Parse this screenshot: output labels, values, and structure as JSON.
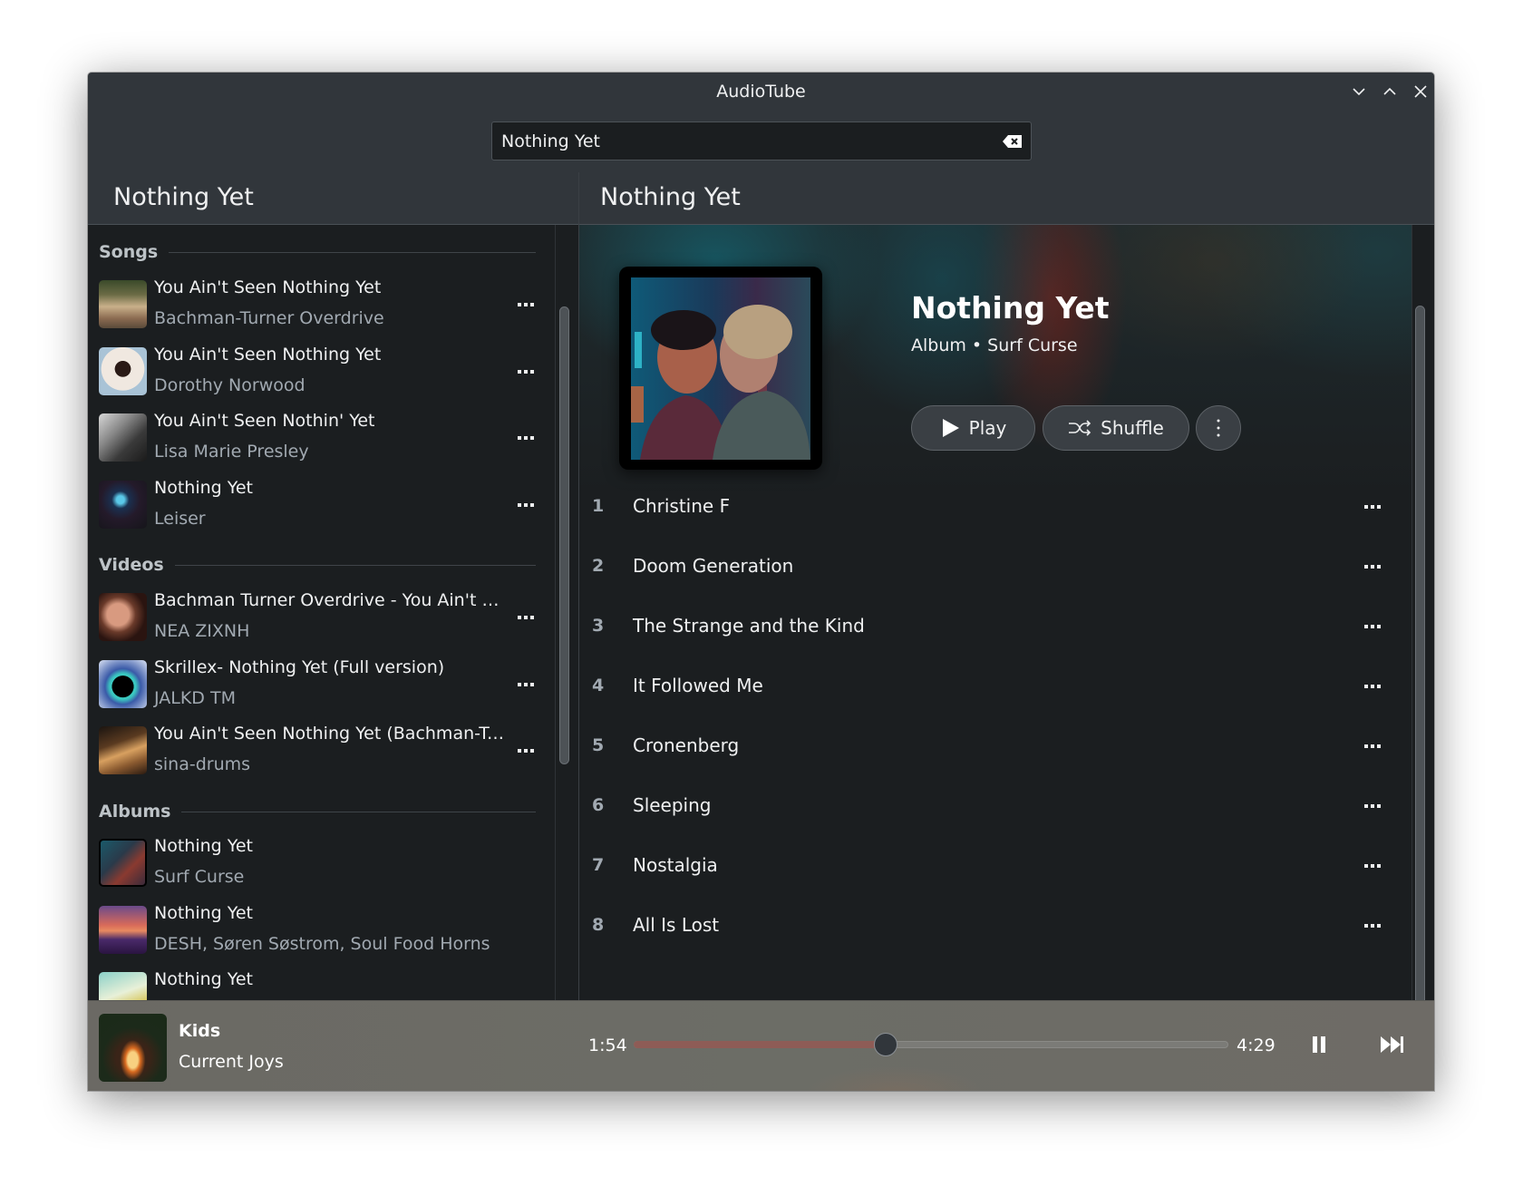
{
  "window": {
    "title": "AudioTube",
    "controls": [
      "minimize",
      "maximize",
      "close"
    ]
  },
  "search": {
    "value": "Nothing Yet",
    "placeholder": "",
    "clear_icon": "clear-text-icon"
  },
  "left_panel": {
    "header": "Nothing Yet",
    "sections": [
      {
        "title": "Songs",
        "items": [
          {
            "title": "You Ain't Seen Nothing Yet",
            "subtitle": "Bachman-Turner Overdrive"
          },
          {
            "title": "You Ain't Seen Nothing Yet",
            "subtitle": "Dorothy Norwood"
          },
          {
            "title": "You Ain't Seen Nothin' Yet",
            "subtitle": "Lisa Marie Presley"
          },
          {
            "title": "Nothing Yet",
            "subtitle": "Leiser"
          }
        ]
      },
      {
        "title": "Videos",
        "items": [
          {
            "title": "Bachman Turner Overdrive - You Ain't Seen Nothing Yet",
            "subtitle": "NEA ZIXNH"
          },
          {
            "title": "Skrillex- Nothing Yet (Full version)",
            "subtitle": "JALKD TM"
          },
          {
            "title": "You Ain't Seen Nothing Yet (Bachman-Turner Overdrive)",
            "subtitle": "sina-drums"
          }
        ]
      },
      {
        "title": "Albums",
        "items": [
          {
            "title": "Nothing Yet",
            "subtitle": "Surf Curse"
          },
          {
            "title": "Nothing Yet",
            "subtitle": "DESH, Søren Søstrom, Soul Food Horns"
          },
          {
            "title": "Nothing Yet",
            "subtitle": ""
          }
        ]
      }
    ],
    "more_icon": "more-horizontal-icon"
  },
  "right_panel": {
    "header": "Nothing Yet",
    "album": {
      "title": "Nothing Yet",
      "subtitle": "Album • Surf Curse",
      "play_label": "Play",
      "shuffle_label": "Shuffle"
    },
    "tracks": [
      {
        "number": "1",
        "title": "Christine F"
      },
      {
        "number": "2",
        "title": "Doom Generation"
      },
      {
        "number": "3",
        "title": "The Strange and the Kind"
      },
      {
        "number": "4",
        "title": "It Followed Me"
      },
      {
        "number": "5",
        "title": "Cronenberg"
      },
      {
        "number": "6",
        "title": "Sleeping"
      },
      {
        "number": "7",
        "title": "Nostalgia"
      },
      {
        "number": "8",
        "title": "All Is Lost"
      }
    ]
  },
  "player": {
    "song": "Kids",
    "artist": "Current Joys",
    "current_time": "1:54",
    "total_time": "4:29",
    "progress_fraction": 0.424,
    "state": "playing",
    "accent_color": "#8e5c56"
  }
}
